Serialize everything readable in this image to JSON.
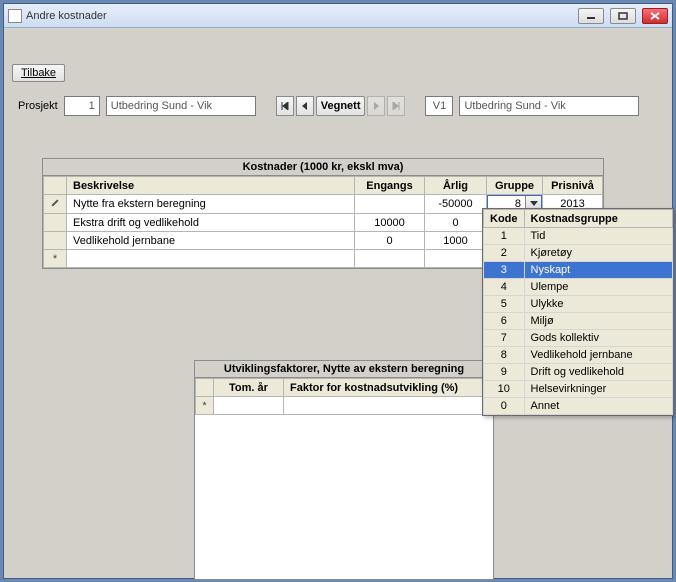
{
  "window": {
    "title": "Andre kostnader"
  },
  "buttons": {
    "tilbake": "Tilbake",
    "vegnett": "Vegnett"
  },
  "project": {
    "label": "Prosjekt",
    "id": "1",
    "name": "Utbedring Sund - Vik",
    "variant_code": "V1",
    "variant_name": "Utbedring Sund - Vik"
  },
  "kostnader": {
    "title": "Kostnader (1000 kr, ekskl mva)",
    "headers": {
      "beskrivelse": "Beskrivelse",
      "engangs": "Engangs",
      "arlig": "Årlig",
      "gruppe": "Gruppe",
      "prisniva": "Prisnivå"
    },
    "rows": [
      {
        "beskrivelse": "Nytte fra ekstern beregning",
        "engangs": "",
        "arlig": "-50000",
        "gruppe": "8",
        "prisniva": "2013"
      },
      {
        "beskrivelse": "Ekstra drift og vedlikehold",
        "engangs": "10000",
        "arlig": "0"
      },
      {
        "beskrivelse": "Vedlikehold jernbane",
        "engangs": "0",
        "arlig": "1000"
      }
    ]
  },
  "utvikling": {
    "title": "Utviklingsfaktorer, Nytte av ekstern beregning",
    "headers": {
      "tom_ar": "Tom. år",
      "faktor": "Faktor for kostnadsutvikling (%)"
    }
  },
  "dropdown": {
    "headers": {
      "kode": "Kode",
      "gruppe": "Kostnadsgruppe"
    },
    "selected_kode": "3",
    "items": [
      {
        "kode": "1",
        "gruppe": "Tid"
      },
      {
        "kode": "2",
        "gruppe": "Kjøretøy"
      },
      {
        "kode": "3",
        "gruppe": "Nyskapt"
      },
      {
        "kode": "4",
        "gruppe": "Ulempe"
      },
      {
        "kode": "5",
        "gruppe": "Ulykke"
      },
      {
        "kode": "6",
        "gruppe": "Miljø"
      },
      {
        "kode": "7",
        "gruppe": "Gods kollektiv"
      },
      {
        "kode": "8",
        "gruppe": "Vedlikehold jernbane"
      },
      {
        "kode": "9",
        "gruppe": "Drift og vedlikehold"
      },
      {
        "kode": "10",
        "gruppe": "Helsevirkninger"
      },
      {
        "kode": "0",
        "gruppe": "Annet"
      }
    ]
  }
}
